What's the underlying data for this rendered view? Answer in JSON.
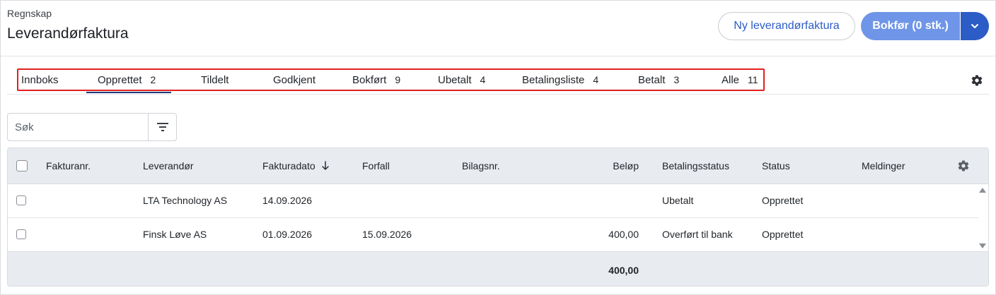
{
  "header": {
    "breadcrumb": "Regnskap",
    "title": "Leverandørfaktura",
    "new_invoice_label": "Ny leverandørfaktura",
    "post_label": "Bokfør (0 stk.)"
  },
  "tabs": [
    {
      "label": "Innboks",
      "count": ""
    },
    {
      "label": "Opprettet",
      "count": "2"
    },
    {
      "label": "Tildelt",
      "count": ""
    },
    {
      "label": "Godkjent",
      "count": ""
    },
    {
      "label": "Bokført",
      "count": "9"
    },
    {
      "label": "Ubetalt",
      "count": "4"
    },
    {
      "label": "Betalingsliste",
      "count": "4"
    },
    {
      "label": "Betalt",
      "count": "3"
    },
    {
      "label": "Alle",
      "count": "11"
    }
  ],
  "active_tab": "Opprettet",
  "search": {
    "placeholder": "Søk",
    "value": ""
  },
  "table": {
    "columns": {
      "invoice_no": "Fakturanr.",
      "supplier": "Leverandør",
      "invoice_date": "Fakturadato",
      "due": "Forfall",
      "voucher_no": "Bilagsnr.",
      "amount": "Beløp",
      "payment_status": "Betalingsstatus",
      "status": "Status",
      "messages": "Meldinger"
    },
    "rows": [
      {
        "invoice_no": "",
        "supplier": "LTA Technology AS",
        "invoice_date": "14.09.2026",
        "due": "",
        "voucher_no": "",
        "amount": "",
        "payment_status": "Ubetalt",
        "status": "Opprettet",
        "messages": ""
      },
      {
        "invoice_no": "",
        "supplier": "Finsk Løve AS",
        "invoice_date": "01.09.2026",
        "due": "15.09.2026",
        "voucher_no": "",
        "amount": "400,00",
        "payment_status": "Overført til bank",
        "status": "Opprettet",
        "messages": ""
      }
    ],
    "total_amount": "400,00"
  },
  "colors": {
    "accent": "#2c5cc5",
    "primary_button": "#6f95e8",
    "highlight_border": "#e02020",
    "header_bg": "#e8ebf0"
  },
  "icons": {
    "tab_settings": "gear-icon",
    "table_settings": "gear-icon",
    "filter": "filter-icon",
    "split": "chevron-down-icon",
    "sort": "arrow-down-icon"
  }
}
